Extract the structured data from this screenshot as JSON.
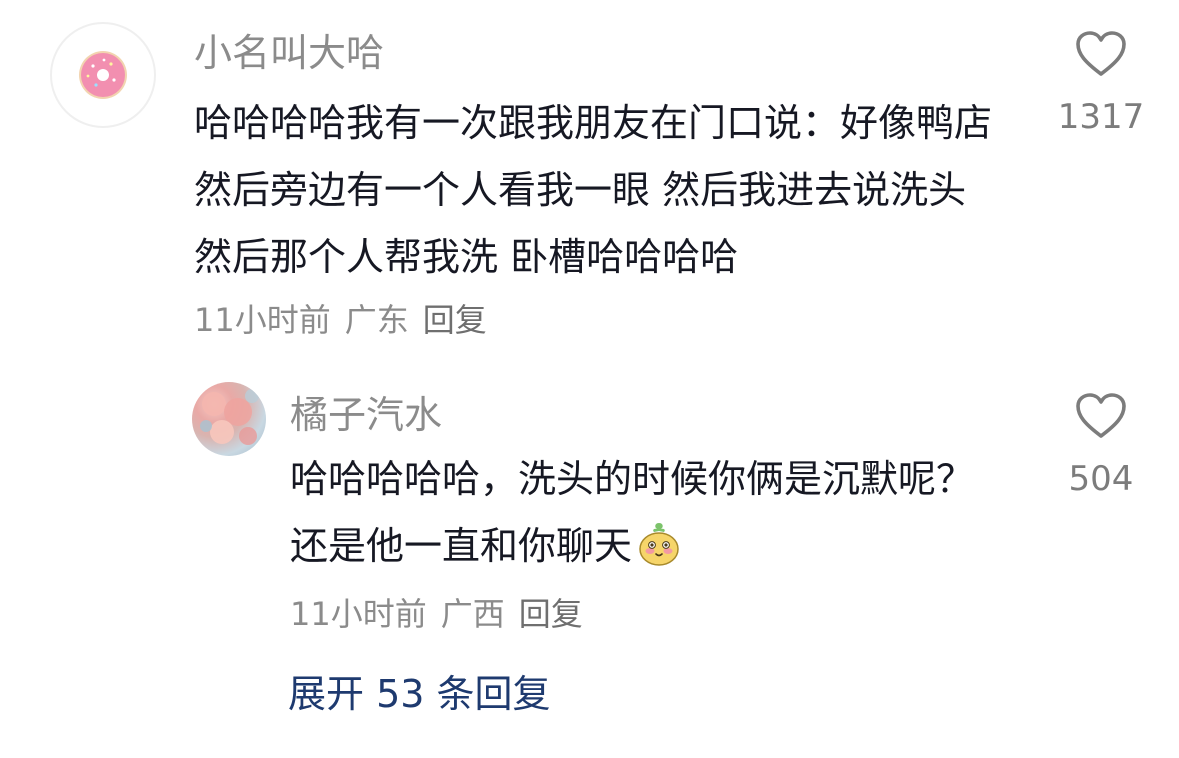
{
  "comment": {
    "username": "小名叫大哈",
    "text": "哈哈哈哈我有一次跟我朋友在门口说：好像鸭店  然后旁边有一个人看我一眼  然后我进去说洗头  然后那个人帮我洗 卧槽哈哈哈哈",
    "time": "11小时前",
    "location": "广东",
    "reply_label": "回复",
    "likes": "1317",
    "avatar_icon": "donut-icon"
  },
  "reply": {
    "username": "橘子汽水",
    "text": "哈哈哈哈哈，洗头的时候你俩是沉默呢？还是他一直和你聊天",
    "emoji_icon": "shy-face-emoji-icon",
    "time": "11小时前",
    "location": "广西",
    "reply_label": "回复",
    "likes": "504",
    "avatar_icon": "flower-photo-avatar"
  },
  "expand_label": "展开 53 条回复",
  "colors": {
    "text": "#161823",
    "secondary": "#8b8b8b",
    "link": "#1e3a6f",
    "donut_pink": "#f28fb0"
  }
}
